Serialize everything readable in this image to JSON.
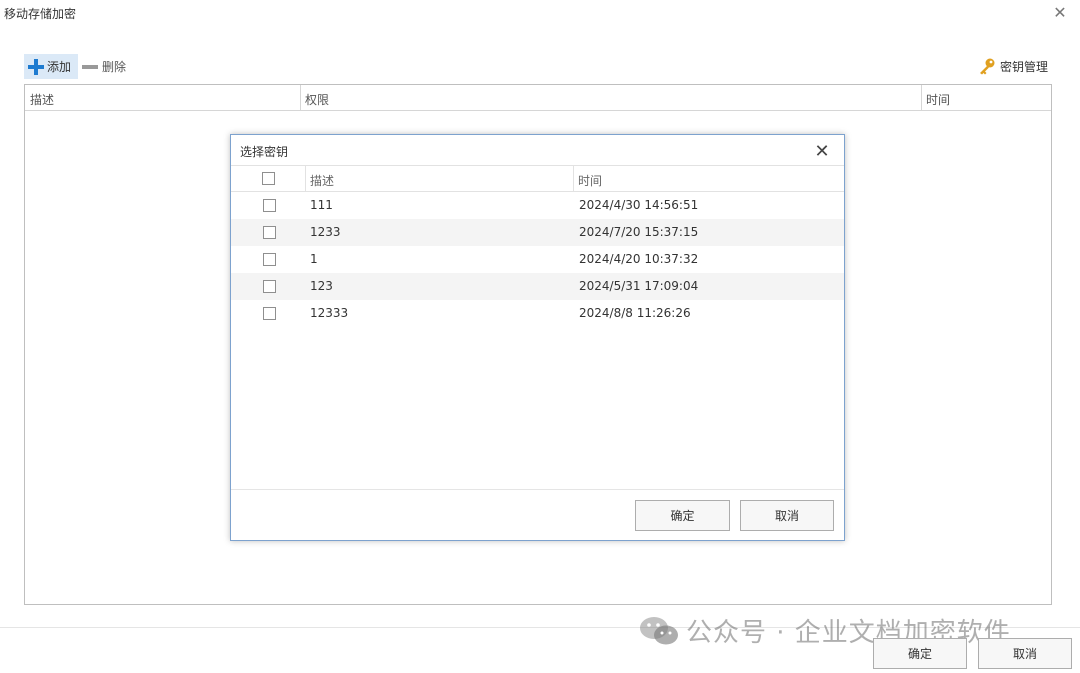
{
  "window": {
    "title": "移动存储加密",
    "close_glyph": "✕"
  },
  "toolbar": {
    "add_label": "添加",
    "delete_label": "删除",
    "key_management_label": "密钥管理",
    "add_icon": "plus-icon",
    "delete_icon": "minus-icon",
    "key_icon": "key-icon",
    "accent_color": "#1e7bd0",
    "key_color": "#e0a020"
  },
  "main_table": {
    "columns": [
      "描述",
      "权限",
      "时间"
    ],
    "rows": []
  },
  "main_buttons": {
    "ok_label": "确定",
    "cancel_label": "取消"
  },
  "dialog": {
    "title": "选择密钥",
    "close_glyph": "✕",
    "columns": [
      "描述",
      "时间"
    ],
    "rows": [
      {
        "desc": "111",
        "time": "2024/4/30 14:56:51",
        "checked": false
      },
      {
        "desc": "1233",
        "time": "2024/7/20 15:37:15",
        "checked": false
      },
      {
        "desc": "1",
        "time": "2024/4/20 10:37:32",
        "checked": false
      },
      {
        "desc": "123",
        "time": "2024/5/31 17:09:04",
        "checked": false
      },
      {
        "desc": "12333",
        "time": "2024/8/8 11:26:26",
        "checked": false
      }
    ],
    "ok_label": "确定",
    "cancel_label": "取消"
  },
  "watermark": {
    "text": "公众号 · 企业文档加密软件",
    "icon": "wechat-icon"
  }
}
